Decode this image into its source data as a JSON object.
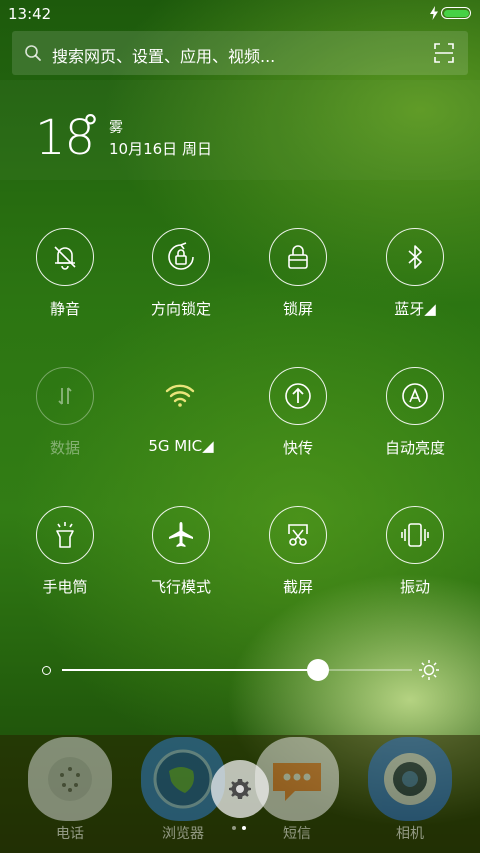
{
  "status_bar": {
    "time": "13:42",
    "battery_color": "#46d145"
  },
  "search": {
    "placeholder": "搜索网页、设置、应用、视频..."
  },
  "weather": {
    "temperature": "18",
    "degree_symbol": "°",
    "condition": "雾",
    "date": "10月16日 周日"
  },
  "toggles": [
    {
      "label": "静音",
      "icon": "bell-off-icon",
      "state": "on"
    },
    {
      "label": "方向锁定",
      "icon": "rotation-lock-icon",
      "state": "on"
    },
    {
      "label": "锁屏",
      "icon": "lock-icon",
      "state": "on"
    },
    {
      "label": "蓝牙◢",
      "icon": "bluetooth-icon",
      "state": "on"
    },
    {
      "label": "数据",
      "icon": "mobile-data-icon",
      "state": "off"
    },
    {
      "label": "5G MIC◢",
      "icon": "wifi-icon",
      "state": "on"
    },
    {
      "label": "快传",
      "icon": "quick-share-icon",
      "state": "on"
    },
    {
      "label": "自动亮度",
      "icon": "auto-brightness-icon",
      "state": "on"
    },
    {
      "label": "手电筒",
      "icon": "flashlight-icon",
      "state": "on"
    },
    {
      "label": "飞行模式",
      "icon": "airplane-icon",
      "state": "on"
    },
    {
      "label": "截屏",
      "icon": "screenshot-icon",
      "state": "on"
    },
    {
      "label": "振动",
      "icon": "vibrate-icon",
      "state": "on"
    }
  ],
  "brightness": {
    "level": 0.73
  },
  "dock": {
    "apps": [
      {
        "name": "电话",
        "icon": "phone-app-icon",
        "color": "#dfe2e4"
      },
      {
        "name": "浏览器",
        "icon": "browser-app-icon",
        "color": "#2f7fd8"
      },
      {
        "name": "短信",
        "icon": "messages-app-icon",
        "color": "#f2f2f2"
      },
      {
        "name": "相机",
        "icon": "camera-app-icon",
        "color": "#2a6fd0"
      }
    ],
    "page_count": 2,
    "current_page": 2
  }
}
